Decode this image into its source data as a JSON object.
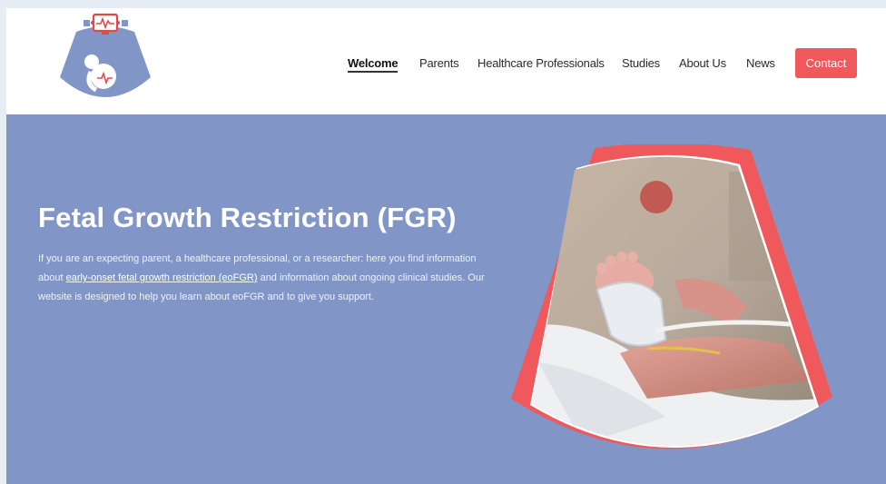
{
  "nav": {
    "items": [
      {
        "label": "Welcome",
        "active": true
      },
      {
        "label": "Parents",
        "active": false
      },
      {
        "label": "Healthcare Professionals",
        "active": false
      },
      {
        "label": "Studies",
        "active": false
      },
      {
        "label": "About Us",
        "active": false
      },
      {
        "label": "News",
        "active": false
      }
    ],
    "contact_label": "Contact"
  },
  "hero": {
    "title": "Fetal Growth Restriction (FGR)",
    "text_before": "If you are an expecting parent, a healthcare professional, or a researcher: here you find information about ",
    "link_text": "early-onset fetal growth restriction (eoFGR)",
    "text_after": " and information about ongoing clinical studies. Our website is designed to help you learn about eoFGR and to give you support."
  },
  "colors": {
    "brand_blue": "#8196c7",
    "accent_red": "#f0595b",
    "header_bg": "#ffffff"
  },
  "icons": [
    "ultrasound-logo-icon",
    "monitor-heartbeat-icon",
    "fetus-icon"
  ]
}
